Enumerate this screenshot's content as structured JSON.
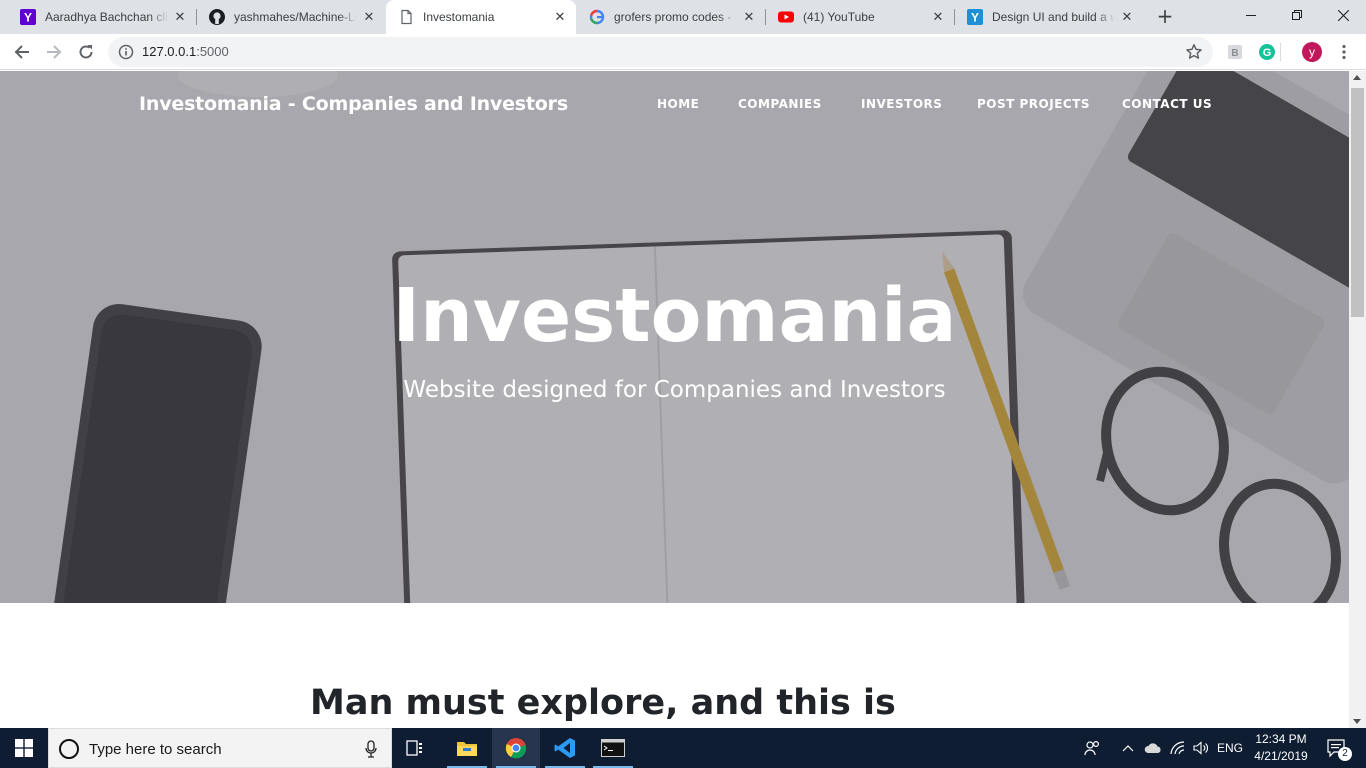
{
  "browser": {
    "tabs": [
      {
        "title": "Aaradhya Bachchan clic",
        "favicon": "yahoo-icon"
      },
      {
        "title": "yashmahes/Machine-Le",
        "favicon": "github-icon"
      },
      {
        "title": "Investomania",
        "favicon": "page-icon",
        "active": true
      },
      {
        "title": "grofers promo codes -",
        "favicon": "google-icon"
      },
      {
        "title": "(41) YouTube",
        "favicon": "youtube-icon"
      },
      {
        "title": "Design UI and build a w",
        "favicon": "yahoo-icon"
      }
    ],
    "new_tab": "+",
    "url_host": "127.0.0.1",
    "url_port": ":5000",
    "profile_initial": "y"
  },
  "site": {
    "brand": "Investomania - Companies and Investors",
    "nav": [
      "HOME",
      "COMPANIES",
      "INVESTORS",
      "POST PROJECTS",
      "CONTACT US"
    ],
    "hero_title": "Investomania",
    "hero_subtitle": "Website designed for Companies and Investors",
    "post_heading": "Man must explore, and this is"
  },
  "taskbar": {
    "search_placeholder": "Type here to search",
    "language": "ENG",
    "time": "12:34 PM",
    "date": "4/21/2019",
    "notification_count": "2"
  },
  "colors": {
    "tabstrip": "#dee1e6",
    "taskbar": "#0f1d33",
    "hero_overlay": "#5a5c64",
    "heading_text": "#212529"
  }
}
